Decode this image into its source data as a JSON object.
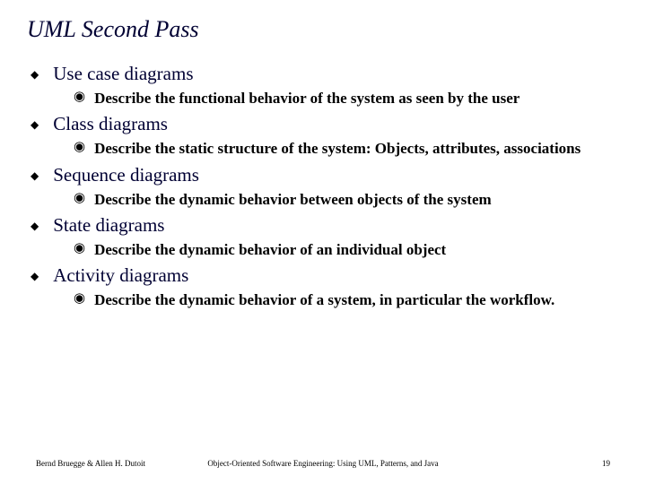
{
  "title": "UML Second Pass",
  "items": [
    {
      "heading": "Use case diagrams",
      "sub": "Describe the functional behavior of the system as seen by the user"
    },
    {
      "heading": "Class diagrams",
      "sub": "Describe the static structure of the system: Objects, attributes, associations"
    },
    {
      "heading": "Sequence diagrams",
      "sub": "Describe the dynamic behavior between objects of the system"
    },
    {
      "heading": "State diagrams",
      "sub": "Describe the dynamic behavior of an individual object"
    },
    {
      "heading": "Activity diagrams",
      "sub": "Describe the dynamic behavior of a system, in particular the workflow."
    }
  ],
  "footer": {
    "left": "Bernd Bruegge & Allen H. Dutoit",
    "center": "Object-Oriented Software Engineering: Using UML, Patterns, and Java",
    "right": "19"
  }
}
